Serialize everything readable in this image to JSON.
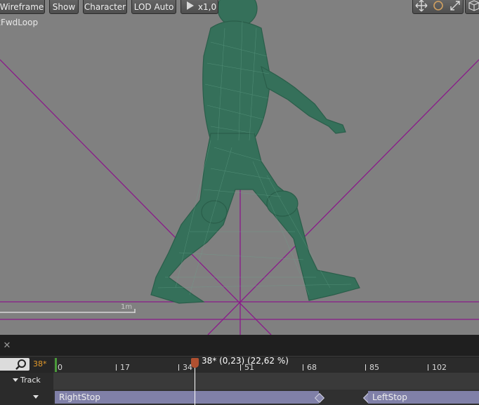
{
  "toolbar": {
    "wireframe_label": "Wireframe",
    "show_label": "Show",
    "character_label": "Character",
    "lod_label": "LOD Auto",
    "playrate_label": "x1,0"
  },
  "viewport": {
    "asset_name": "kFwdLoop",
    "scale_label": "1m",
    "colors": {
      "background": "#808080",
      "mesh": "#2e6b55",
      "grid_lines": "#8a1a8a"
    }
  },
  "timeline": {
    "current_frame": "38*",
    "playhead_label": "38* (0,23) (22,62 %)",
    "ticks": [
      "0",
      "17",
      "34",
      "51",
      "68",
      "85",
      "102"
    ],
    "track_button_label": "Track",
    "notifies": [
      {
        "label": "RightStop"
      },
      {
        "label": "LeftStop"
      }
    ]
  }
}
